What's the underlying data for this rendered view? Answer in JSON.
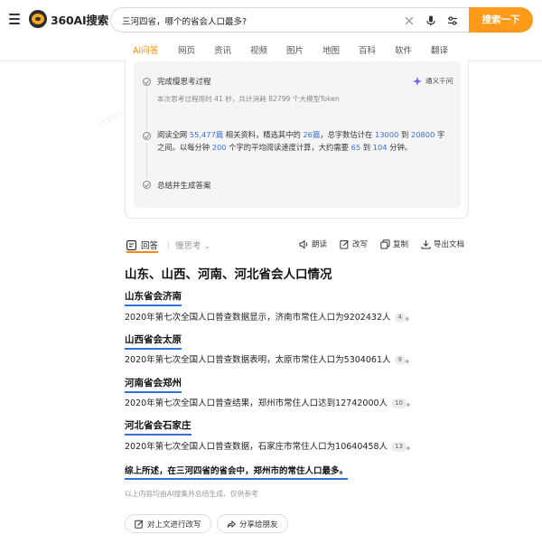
{
  "header": {
    "logo_text": "360AI搜索",
    "search": {
      "value": "三河四省，哪个的省会人口最多?",
      "placeholder": ""
    },
    "search_button": "搜索一下"
  },
  "tabs": [
    "AI问答",
    "网页",
    "资讯",
    "视频",
    "图片",
    "地图",
    "百科",
    "软件",
    "翻译"
  ],
  "thinking": {
    "step1": {
      "title": "完成慢思考过程",
      "sub": "本次思考过程用时 41 秒，共计消耗 82799 个大模型Token",
      "model": "通义千问"
    },
    "step2": {
      "a": "阅读全网 ",
      "pages": "55,477篇",
      "b": " 相关资料，精选其中的 ",
      "picked": "26篇",
      "c": "，总字数估计在 ",
      "min": "13000",
      "d": " 到 ",
      "max": "20800",
      "e": " 字",
      "f": "之间。以每分钟 ",
      "speed": "200",
      "g": " 个字的平均阅读速度计算，大约需要 ",
      "tmin": "65",
      "h": " 到 ",
      "tmax": "104",
      "i": " 分钟。"
    },
    "step3": {
      "title": "总结并生成答案"
    }
  },
  "answer_bar": {
    "answer_tab": "回答",
    "think_tab": "慢思考 ⌄",
    "tools": [
      "朗读",
      "改写",
      "复制",
      "导出文档"
    ]
  },
  "answer": {
    "title": "山东、山西、河南、河北省会人口情况",
    "sections": [
      {
        "heading": "山东省会济南",
        "text": "2020年第七次全国人口普查数据显示，济南市常住人口为9202432人",
        "cite": "4",
        "end": "。"
      },
      {
        "heading": "山西省会太原",
        "text": "2020年第七次全国人口普查数据表明，太原市常住人口为5304061人",
        "cite": "9",
        "end": "。"
      },
      {
        "heading": "河南省会郑州",
        "text": "2020年第七次全国人口普查结果，郑州市常住人口达到12742000人",
        "cite": "10",
        "end": "。"
      },
      {
        "heading": "河北省会石家庄",
        "text": "2020年第七次全国人口普查数据，石家庄市常住人口为10640458人",
        "cite": "13",
        "end": "。"
      }
    ],
    "summary": "综上所述，在三河四省的省会中，郑州市的常住人口最多。",
    "disclaimer": "以上内容均由AI搜集并总结生成，仅供参考",
    "actions": [
      "对上文进行改写",
      "分享给朋友"
    ]
  },
  "colors": {
    "accent": "#ff8a00",
    "search_button": "#ff9a1b",
    "link_blue": "#3a6fd8"
  },
  "icons": [
    "menu-icon",
    "clear-icon",
    "microphone-icon",
    "filter-icon",
    "check-circle-icon",
    "sparkle-icon",
    "answer-icon",
    "speaker-icon",
    "edit-icon",
    "copy-icon",
    "export-icon",
    "share-icon"
  ]
}
